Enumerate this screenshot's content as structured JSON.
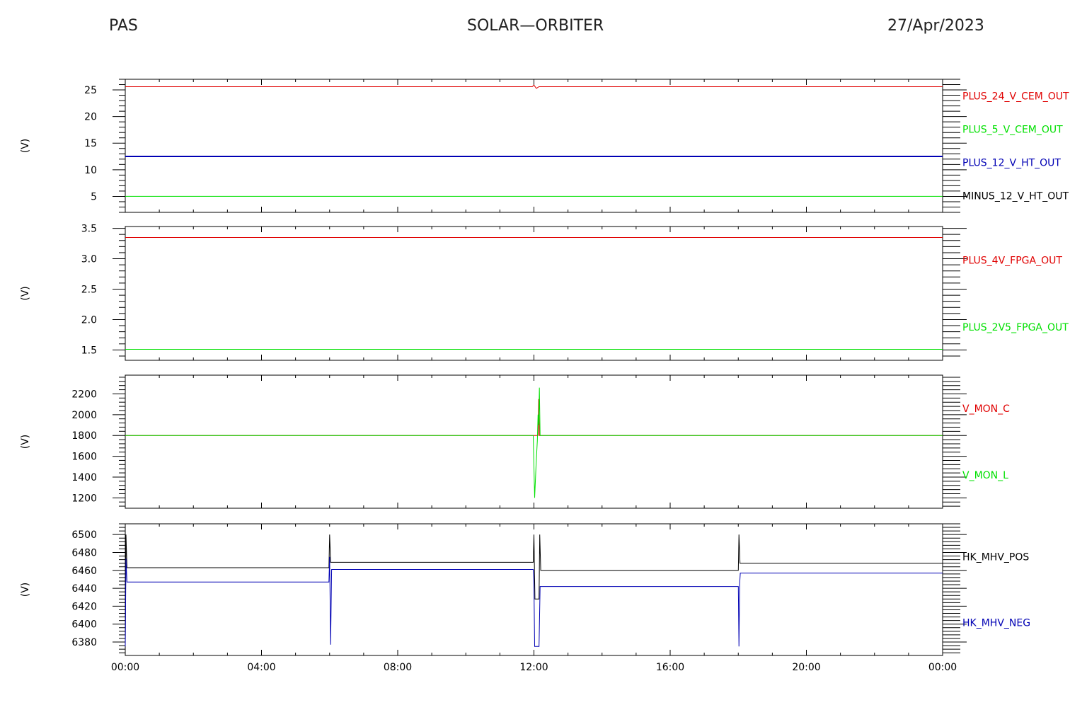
{
  "header": {
    "left": "PAS",
    "center": "SOLAR—ORBITER",
    "right": "27/Apr/2023"
  },
  "colors": {
    "red": "#e00000",
    "green": "#00e000",
    "blue": "#0000b4",
    "black": "#000000"
  },
  "chart_data": [
    {
      "type": "line",
      "ylabel": "(V)",
      "ylim": [
        2,
        27
      ],
      "yticks": [
        5,
        10,
        15,
        20,
        25
      ],
      "ytick_labels": [
        "5",
        "10",
        "15",
        "20",
        "25"
      ],
      "legend": [
        {
          "name": "PLUS_24_V_CEM_OUT",
          "color": "red"
        },
        {
          "name": "PLUS_5_V_CEM_OUT",
          "color": "green"
        },
        {
          "name": "PLUS_12_V_HT_OUT",
          "color": "blue"
        },
        {
          "name": "MINUS_12_V_HT_OUT",
          "color": "black"
        }
      ],
      "series": [
        {
          "name": "PLUS_24_V_CEM_OUT",
          "color": "red",
          "points": [
            [
              0,
              25.6
            ],
            [
              11.95,
              25.6
            ],
            [
              12.0,
              25.9
            ],
            [
              12.07,
              25.3
            ],
            [
              12.15,
              25.6
            ],
            [
              24,
              25.6
            ]
          ]
        },
        {
          "name": "PLUS_5_V_CEM_OUT",
          "color": "green",
          "points": [
            [
              0,
              5.0
            ],
            [
              24,
              5.0
            ]
          ]
        },
        {
          "name": "PLUS_12_V_HT_OUT",
          "color": "blue",
          "width": 2,
          "points": [
            [
              0,
              12.5
            ],
            [
              24,
              12.5
            ]
          ]
        }
      ]
    },
    {
      "type": "line",
      "ylabel": "(V)",
      "ylim": [
        1.33,
        3.53
      ],
      "yticks": [
        1.5,
        2.0,
        2.5,
        3.0,
        3.5
      ],
      "ytick_labels": [
        "1.5",
        "2.0",
        "2.5",
        "3.0",
        "3.5"
      ],
      "legend": [
        {
          "name": "PLUS_4V_FPGA_OUT",
          "color": "red"
        },
        {
          "name": "PLUS_2V5_FPGA_OUT",
          "color": "green"
        }
      ],
      "series": [
        {
          "name": "PLUS_4V_FPGA_OUT",
          "color": "red",
          "points": [
            [
              0,
              3.35
            ],
            [
              24,
              3.35
            ]
          ]
        },
        {
          "name": "PLUS_2V5_FPGA_OUT",
          "color": "green",
          "points": [
            [
              0,
              1.51
            ],
            [
              24,
              1.51
            ]
          ]
        }
      ]
    },
    {
      "type": "line",
      "ylabel": "(V)",
      "ylim": [
        1100,
        2380
      ],
      "yticks": [
        1200,
        1400,
        1600,
        1800,
        2000,
        2200
      ],
      "ytick_labels": [
        "1200",
        "1400",
        "1600",
        "1800",
        "2000",
        "2200"
      ],
      "legend": [
        {
          "name": "V_MON_C",
          "color": "red"
        },
        {
          "name": "V_MON_L",
          "color": "green"
        }
      ],
      "series": [
        {
          "name": "V_MON_C",
          "color": "red",
          "points": [
            [
              0,
              1800
            ],
            [
              12.12,
              1800
            ],
            [
              12.14,
              2150
            ],
            [
              12.16,
              1800
            ],
            [
              24,
              1800
            ]
          ]
        },
        {
          "name": "V_MON_L",
          "color": "green",
          "points": [
            [
              0,
              1800
            ],
            [
              11.98,
              1800
            ],
            [
              12.02,
              1200
            ],
            [
              12.06,
              1500
            ],
            [
              12.1,
              1750
            ],
            [
              12.12,
              2000
            ],
            [
              12.14,
              1900
            ],
            [
              12.16,
              2260
            ],
            [
              12.18,
              1800
            ],
            [
              24,
              1800
            ]
          ]
        }
      ]
    },
    {
      "type": "line",
      "ylabel": "(V)",
      "ylim": [
        6365,
        6512
      ],
      "yticks": [
        6380,
        6400,
        6420,
        6440,
        6460,
        6480,
        6500
      ],
      "ytick_labels": [
        "6380",
        "6400",
        "6420",
        "6440",
        "6460",
        "6480",
        "6500"
      ],
      "xlim": [
        0,
        24
      ],
      "xticks": [
        0,
        4,
        8,
        12,
        16,
        20,
        24
      ],
      "xtick_labels": [
        "00:00",
        "04:00",
        "08:00",
        "12:00",
        "16:00",
        "20:00",
        "00:00"
      ],
      "legend": [
        {
          "name": "HK_MHV_POS",
          "color": "black"
        },
        {
          "name": "HK_MHV_NEG",
          "color": "blue"
        }
      ],
      "series": [
        {
          "name": "HK_MHV_POS",
          "color": "black",
          "points": [
            [
              0,
              6378
            ],
            [
              0.02,
              6500
            ],
            [
              0.05,
              6463
            ],
            [
              5.98,
              6463
            ],
            [
              6.0,
              6500
            ],
            [
              6.03,
              6469
            ],
            [
              11.98,
              6469
            ],
            [
              12.0,
              6500
            ],
            [
              12.03,
              6428
            ],
            [
              12.15,
              6428
            ],
            [
              12.17,
              6500
            ],
            [
              12.2,
              6460
            ],
            [
              18.0,
              6460
            ],
            [
              18.02,
              6500
            ],
            [
              18.05,
              6468
            ],
            [
              24,
              6468
            ]
          ]
        },
        {
          "name": "HK_MHV_NEG",
          "color": "blue",
          "points": [
            [
              0,
              6375
            ],
            [
              0.02,
              6473
            ],
            [
              0.05,
              6447
            ],
            [
              5.98,
              6447
            ],
            [
              6.0,
              6475
            ],
            [
              6.03,
              6377
            ],
            [
              6.06,
              6461
            ],
            [
              11.98,
              6461
            ],
            [
              12.0,
              6445
            ],
            [
              12.02,
              6375
            ],
            [
              12.15,
              6375
            ],
            [
              12.18,
              6442
            ],
            [
              18.0,
              6442
            ],
            [
              18.02,
              6375
            ],
            [
              18.04,
              6445
            ],
            [
              18.06,
              6457
            ],
            [
              24,
              6457
            ]
          ]
        }
      ]
    }
  ]
}
